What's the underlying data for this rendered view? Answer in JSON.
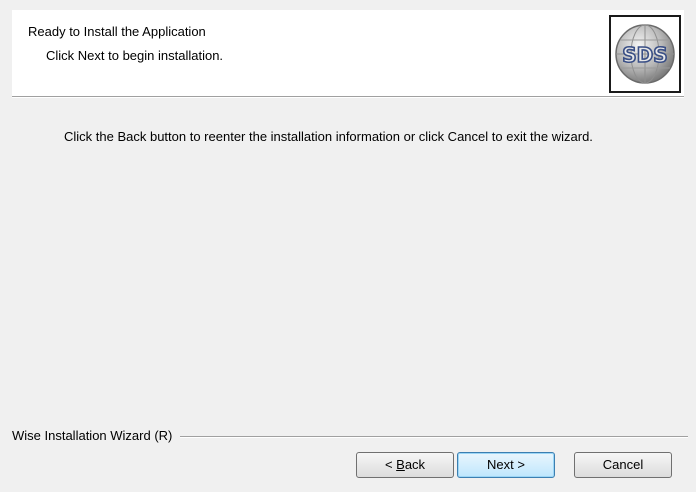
{
  "header": {
    "title": "Ready to Install the Application",
    "subtitle": "Click Next to begin installation.",
    "logo_text": "SDS"
  },
  "body": {
    "message": "Click the Back button to reenter the installation information or click Cancel to exit the wizard."
  },
  "footer": {
    "branding": "Wise Installation Wizard (R)"
  },
  "buttons": {
    "back_prefix": "< ",
    "back_mnemonic": "B",
    "back_rest": "ack",
    "next_label": "Next >",
    "cancel_label": "Cancel"
  },
  "colors": {
    "dialog_bg": "#f0f0f0",
    "header_bg": "#ffffff",
    "default_button_border": "#3c7fb1"
  }
}
